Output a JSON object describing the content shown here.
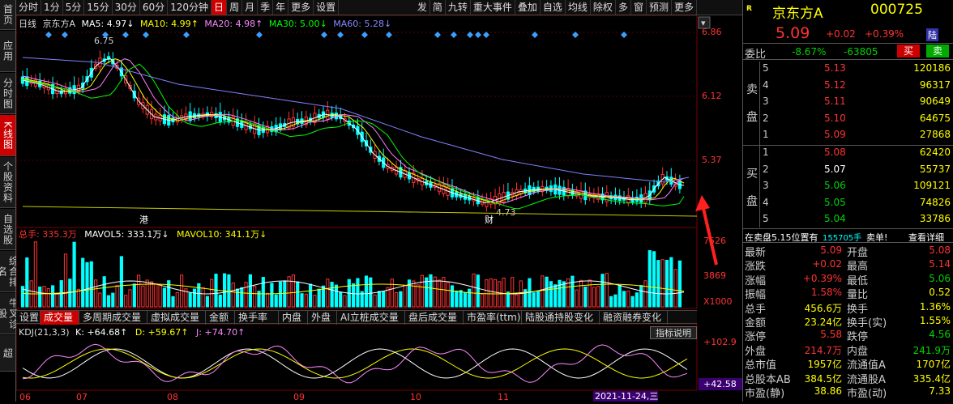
{
  "sidebar": [
    "首页",
    "应用",
    "分时图",
    "K线图",
    "个股资料",
    "自选股",
    "综合排名",
    "牛叉诊股",
    "超"
  ],
  "toolbar": {
    "left": [
      "分时",
      "1分",
      "5分",
      "15分",
      "30分",
      "60分",
      "120分钟",
      "日",
      "周",
      "月",
      "季",
      "年",
      "更多",
      "设置"
    ],
    "right": [
      "发",
      "简",
      "九转",
      "重大事件",
      "叠加",
      "自选",
      "均线",
      "除权",
      "多",
      "窗",
      "预测",
      "更多"
    ],
    "active": "日"
  },
  "legend": {
    "period": "日线",
    "name": "京东方A",
    "ma5": "MA5: 4.97",
    "ma10": "MA10: 4.99",
    "ma20": "MA20: 4.98",
    "ma30": "MA30: 5.00",
    "ma60": "MA60: 5.28"
  },
  "price_axis": [
    "6.86",
    "6.12",
    "5.37"
  ],
  "chart_labels": {
    "high": "6.75",
    "low": "4.73",
    "gang": "港",
    "cai": "财"
  },
  "vol_legend": {
    "total": "总手: 335.3万",
    "mavol5": "MAVOL5: 333.1万",
    "mavol10": "MAVOL10: 341.1万"
  },
  "vol_axis": [
    "7526",
    "3869",
    "X1000"
  ],
  "tabs": [
    "设置",
    "成交量",
    "多周期成交量",
    "虚拟成交量",
    "金额",
    "换手率",
    "内盘",
    "外盘",
    "AI立桩成交量",
    "盘后成交量",
    "市盈率(ttm)",
    "陆股通持股变化",
    "融资融券变化"
  ],
  "active_tab": "成交量",
  "kdj": {
    "label": "KDJ(21,3,3)",
    "k": "K: +64.68",
    "d": "D: +59.67",
    "j": "J: +74.70",
    "btn": "指标说明",
    "axis_top": "+102.9",
    "axis_val": "+42.58"
  },
  "months": [
    "06",
    "07",
    "08",
    "09",
    "10",
    "11"
  ],
  "date_badge": "2021-11-24,三",
  "quote": {
    "name": "京东方A",
    "code": "000725",
    "price": "5.09",
    "change": "+0.02",
    "pct": "+0.39%",
    "flag": "陆",
    "weibi_label": "委比",
    "weibi": "-8.67%",
    "weicha": "-63805",
    "buy_btn": "买",
    "sell_btn": "卖",
    "sell": [
      {
        "n": "5",
        "p": "5.13",
        "v": "120186"
      },
      {
        "n": "4",
        "p": "5.12",
        "v": "96317"
      },
      {
        "n": "3",
        "p": "5.11",
        "v": "90649"
      },
      {
        "n": "2",
        "p": "5.10",
        "v": "64675"
      },
      {
        "n": "1",
        "p": "5.09",
        "v": "27868"
      }
    ],
    "buy": [
      {
        "n": "1",
        "p": "5.08",
        "v": "62420"
      },
      {
        "n": "2",
        "p": "5.07",
        "v": "55737"
      },
      {
        "n": "3",
        "p": "5.06",
        "v": "109121"
      },
      {
        "n": "4",
        "p": "5.05",
        "v": "74826"
      },
      {
        "n": "5",
        "p": "5.04",
        "v": "33786"
      }
    ],
    "sell_side": [
      "卖",
      "盘"
    ],
    "buy_side": [
      "买",
      "盘"
    ],
    "notice": "在卖盘5.15位置有",
    "notice_vol": "155705手",
    "notice_tail": "卖单!",
    "notice_link": "查看详细",
    "stats": [
      [
        "最新",
        "5.09",
        "开盘",
        "5.08"
      ],
      [
        "涨跌",
        "+0.02",
        "最高",
        "5.14"
      ],
      [
        "涨幅",
        "+0.39%",
        "最低",
        "5.06"
      ],
      [
        "振幅",
        "1.58%",
        "量比",
        "0.52"
      ],
      [
        "总手",
        "456.6万",
        "换手",
        "1.36%"
      ],
      [
        "金额",
        "23.24亿",
        "换手(实)",
        "1.55%"
      ],
      [
        "涨停",
        "5.58",
        "跌停",
        "4.56"
      ],
      [
        "外盘",
        "214.7万",
        "内盘",
        "241.9万"
      ],
      [
        "总市值",
        "1957亿",
        "流通值A",
        "1707亿"
      ],
      [
        "总股本AB",
        "384.5亿",
        "流通股A",
        "335.4亿"
      ],
      [
        "市盈(静)",
        "38.86",
        "市盈(动)",
        "7.33"
      ]
    ]
  },
  "colors": {
    "up": "#ff3232",
    "down": "#00ffff",
    "ma5": "#ffffff",
    "ma10": "#ffff00",
    "ma20": "#ff80ff",
    "ma30": "#00ff00",
    "ma60": "#8080ff"
  }
}
